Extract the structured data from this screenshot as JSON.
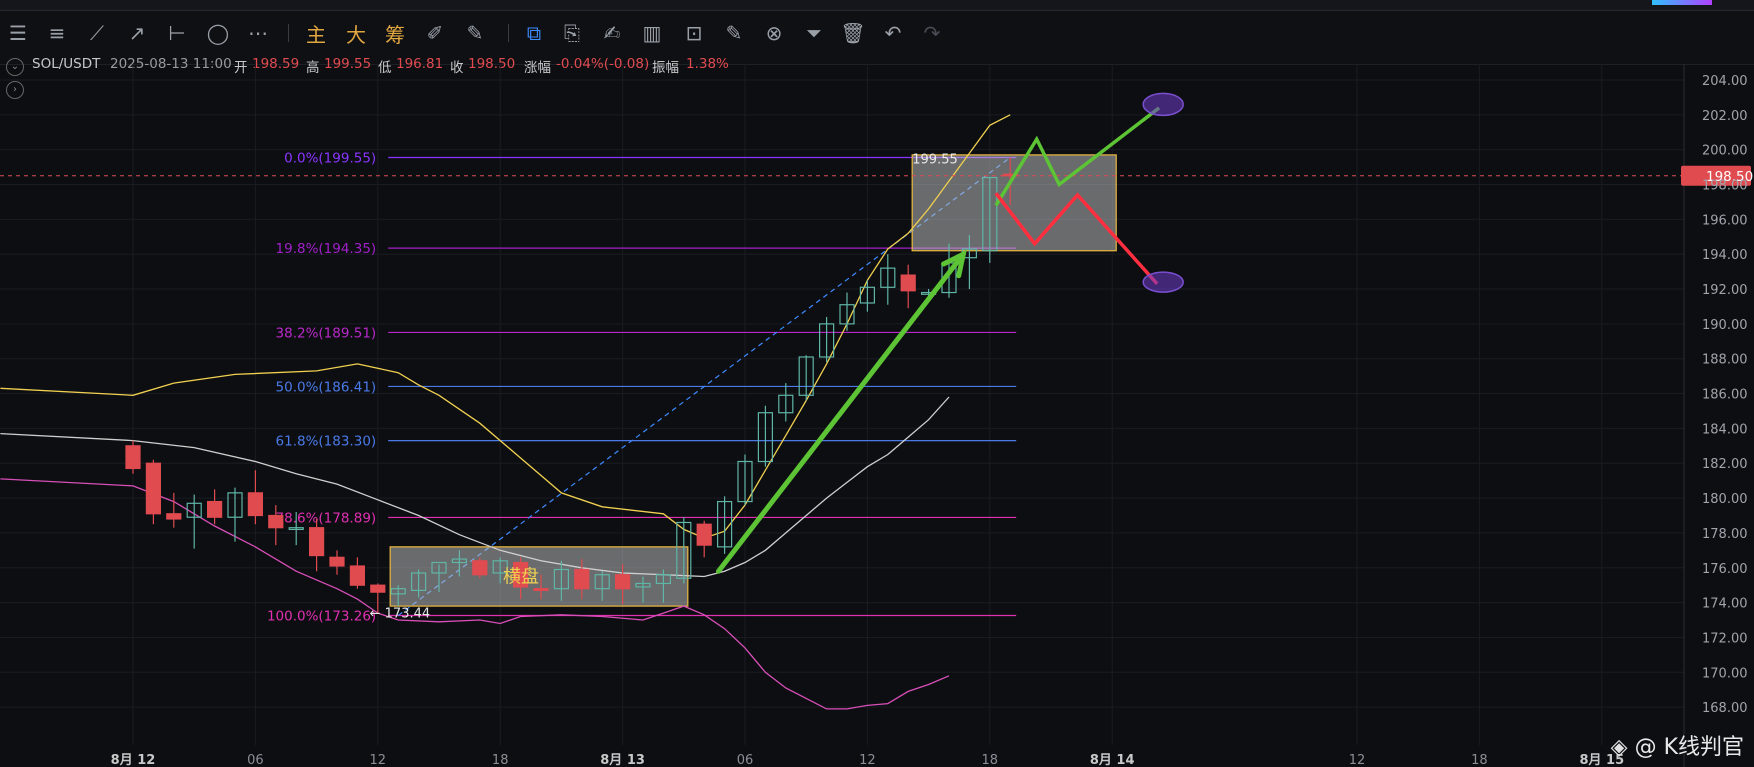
{
  "toolbar": {
    "left_tools": [
      "menu-icon",
      "horizontal-lines-icon",
      "trend-line-icon",
      "ray-icon",
      "horizontal-line-icon",
      "ellipse-icon",
      "more-icon"
    ],
    "indicator_buttons": [
      "主",
      "大",
      "筹"
    ],
    "right_tools": [
      "replay-icon",
      "brush-icon",
      "copy-icon",
      "ruler-icon",
      "pen-icon",
      "candle-type-icon",
      "lock-icon",
      "edit-icon",
      "magnet-icon",
      "filter-icon",
      "trash-icon",
      "undo-icon",
      "redo-icon"
    ]
  },
  "info": {
    "symbol": "SOL/USDT",
    "datetime": "2025-08-13 11:00",
    "open_label": "开",
    "open": "198.59",
    "high_label": "高",
    "high": "199.55",
    "low_label": "低",
    "low": "196.81",
    "close_label": "收",
    "close": "198.50",
    "change_label": "涨幅",
    "change": "-0.04%(-0.08)",
    "amplitude_label": "振幅",
    "amplitude": "1.38%"
  },
  "watermark": "@ K线判官",
  "colors": {
    "background": "#0d0e12",
    "up": "#5fb5a6",
    "down": "#e04b50",
    "price_tag": "#e04b50",
    "boll_upper": "#f0d050",
    "boll_mid": "#cfcfcf",
    "boll_lower": "#d84fb8",
    "arrow": "#5cc435",
    "green_path": "#5cc435",
    "red_path": "#ff2f3f",
    "ellipse": "#7a4fd0"
  },
  "chart_data": {
    "type": "candlestick",
    "symbol": "SOL/USDT",
    "interval_hours": 1,
    "ylim": [
      167,
      205
    ],
    "y_ticks": [
      "204.00",
      "202.00",
      "200.00",
      "198.00",
      "196.00",
      "194.00",
      "192.00",
      "190.00",
      "188.00",
      "186.00",
      "184.00",
      "182.00",
      "180.00",
      "178.00",
      "176.00",
      "174.00",
      "172.00",
      "170.00",
      "168.00"
    ],
    "x_ticks": [
      {
        "label": "8月 12",
        "t": 0,
        "bold": true
      },
      {
        "label": "06",
        "t": 6
      },
      {
        "label": "12",
        "t": 12
      },
      {
        "label": "18",
        "t": 18
      },
      {
        "label": "8月 13",
        "t": 24,
        "bold": true
      },
      {
        "label": "06",
        "t": 30
      },
      {
        "label": "12",
        "t": 36
      },
      {
        "label": "18",
        "t": 42
      },
      {
        "label": "8月 14",
        "t": 48,
        "bold": true
      },
      {
        "label": "12",
        "t": 60
      },
      {
        "label": "18",
        "t": 66
      },
      {
        "label": "8月 15",
        "t": 72,
        "bold": true
      }
    ],
    "current_price": "198.50",
    "candles": [
      {
        "o": 183.0,
        "h": 183.3,
        "l": 181.4,
        "c": 181.7
      },
      {
        "o": 182.0,
        "h": 182.2,
        "l": 178.5,
        "c": 179.1
      },
      {
        "o": 179.1,
        "h": 180.3,
        "l": 178.3,
        "c": 178.8
      },
      {
        "o": 178.9,
        "h": 180.2,
        "l": 177.1,
        "c": 179.7
      },
      {
        "o": 179.8,
        "h": 180.5,
        "l": 178.5,
        "c": 178.9
      },
      {
        "o": 178.9,
        "h": 180.6,
        "l": 177.5,
        "c": 180.3
      },
      {
        "o": 180.3,
        "h": 181.6,
        "l": 178.5,
        "c": 179.0
      },
      {
        "o": 179.0,
        "h": 179.6,
        "l": 177.3,
        "c": 178.3
      },
      {
        "o": 178.2,
        "h": 179.2,
        "l": 177.3,
        "c": 178.3
      },
      {
        "o": 178.3,
        "h": 178.8,
        "l": 175.8,
        "c": 176.7
      },
      {
        "o": 176.6,
        "h": 177.0,
        "l": 175.6,
        "c": 176.1
      },
      {
        "o": 176.1,
        "h": 176.6,
        "l": 174.8,
        "c": 175.0
      },
      {
        "o": 175.0,
        "h": 175.1,
        "l": 173.4,
        "c": 174.6
      },
      {
        "o": 174.5,
        "h": 175.0,
        "l": 173.8,
        "c": 174.8
      },
      {
        "o": 174.7,
        "h": 175.9,
        "l": 174.3,
        "c": 175.7
      },
      {
        "o": 175.7,
        "h": 176.2,
        "l": 174.6,
        "c": 176.3
      },
      {
        "o": 176.3,
        "h": 177.0,
        "l": 175.5,
        "c": 176.5
      },
      {
        "o": 176.4,
        "h": 176.6,
        "l": 175.4,
        "c": 175.6
      },
      {
        "o": 175.7,
        "h": 176.6,
        "l": 175.1,
        "c": 176.4
      },
      {
        "o": 176.3,
        "h": 176.6,
        "l": 174.2,
        "c": 174.9
      },
      {
        "o": 174.8,
        "h": 175.6,
        "l": 174.2,
        "c": 174.7
      },
      {
        "o": 174.8,
        "h": 176.4,
        "l": 174.1,
        "c": 175.9
      },
      {
        "o": 175.9,
        "h": 176.5,
        "l": 174.2,
        "c": 174.8
      },
      {
        "o": 174.8,
        "h": 175.8,
        "l": 174.1,
        "c": 175.6
      },
      {
        "o": 175.6,
        "h": 176.2,
        "l": 173.9,
        "c": 174.8
      },
      {
        "o": 174.9,
        "h": 175.5,
        "l": 174.0,
        "c": 175.1
      },
      {
        "o": 175.1,
        "h": 175.9,
        "l": 174.0,
        "c": 175.6
      },
      {
        "o": 175.4,
        "h": 178.9,
        "l": 175.1,
        "c": 178.6
      },
      {
        "o": 178.5,
        "h": 178.7,
        "l": 176.6,
        "c": 177.3
      },
      {
        "o": 177.2,
        "h": 180.1,
        "l": 176.8,
        "c": 179.8
      },
      {
        "o": 179.8,
        "h": 182.5,
        "l": 179.6,
        "c": 182.1
      },
      {
        "o": 182.1,
        "h": 185.3,
        "l": 181.8,
        "c": 184.9
      },
      {
        "o": 184.9,
        "h": 186.6,
        "l": 184.4,
        "c": 185.9
      },
      {
        "o": 185.9,
        "h": 188.2,
        "l": 185.6,
        "c": 188.1
      },
      {
        "o": 188.1,
        "h": 190.4,
        "l": 187.8,
        "c": 190.0
      },
      {
        "o": 190.0,
        "h": 191.8,
        "l": 189.6,
        "c": 191.1
      },
      {
        "o": 191.2,
        "h": 192.5,
        "l": 190.7,
        "c": 192.1
      },
      {
        "o": 192.1,
        "h": 194.0,
        "l": 191.1,
        "c": 193.2
      },
      {
        "o": 192.8,
        "h": 193.4,
        "l": 190.9,
        "c": 191.9
      },
      {
        "o": 191.7,
        "h": 192.0,
        "l": 191.3,
        "c": 191.8
      },
      {
        "o": 191.8,
        "h": 194.6,
        "l": 191.5,
        "c": 193.5
      },
      {
        "o": 193.8,
        "h": 195.1,
        "l": 192.0,
        "c": 194.3
      },
      {
        "o": 194.2,
        "h": 198.4,
        "l": 193.5,
        "c": 198.4
      },
      {
        "o": 198.59,
        "h": 199.55,
        "l": 196.81,
        "c": 198.5
      }
    ],
    "bollinger": {
      "upper": [
        [
          0,
          185.9
        ],
        [
          2,
          186.6
        ],
        [
          5,
          187.1
        ],
        [
          9,
          187.3
        ],
        [
          11,
          187.7
        ],
        [
          13,
          187.2
        ],
        [
          14,
          186.5
        ],
        [
          15,
          185.9
        ],
        [
          17,
          184.3
        ],
        [
          19,
          182.3
        ],
        [
          21,
          180.3
        ],
        [
          23,
          179.5
        ],
        [
          26,
          179.1
        ],
        [
          27,
          178.2
        ],
        [
          28,
          177.7
        ],
        [
          29,
          178.1
        ],
        [
          30,
          179.6
        ],
        [
          31,
          181.6
        ],
        [
          32,
          183.6
        ],
        [
          33,
          185.6
        ],
        [
          34,
          187.7
        ],
        [
          35,
          190.0
        ],
        [
          36,
          192.5
        ],
        [
          37,
          194.3
        ],
        [
          38,
          195.2
        ],
        [
          39,
          196.6
        ],
        [
          40,
          198.2
        ],
        [
          41,
          199.8
        ],
        [
          42,
          201.4
        ],
        [
          43,
          202.0
        ]
      ],
      "middle": [
        [
          0,
          183.3
        ],
        [
          3,
          182.9
        ],
        [
          6,
          182.1
        ],
        [
          8,
          181.4
        ],
        [
          10,
          180.8
        ],
        [
          12,
          179.9
        ],
        [
          14,
          179.0
        ],
        [
          16,
          177.9
        ],
        [
          18,
          177.0
        ],
        [
          20,
          176.4
        ],
        [
          22,
          176.0
        ],
        [
          24,
          175.7
        ],
        [
          26,
          175.6
        ],
        [
          28,
          175.5
        ],
        [
          29,
          175.8
        ],
        [
          30,
          176.3
        ],
        [
          31,
          177.0
        ],
        [
          32,
          178.0
        ],
        [
          33,
          179.0
        ],
        [
          34,
          180.0
        ],
        [
          35,
          180.9
        ],
        [
          36,
          181.8
        ],
        [
          37,
          182.5
        ],
        [
          38,
          183.5
        ],
        [
          39,
          184.5
        ],
        [
          40,
          185.8
        ]
      ],
      "lower": [
        [
          0,
          180.7
        ],
        [
          2,
          179.8
        ],
        [
          4,
          178.4
        ],
        [
          6,
          177.2
        ],
        [
          8,
          175.8
        ],
        [
          10,
          174.8
        ],
        [
          11,
          174.2
        ],
        [
          12,
          173.4
        ],
        [
          13,
          173.0
        ],
        [
          15,
          172.9
        ],
        [
          17,
          173.0
        ],
        [
          18,
          172.8
        ],
        [
          19,
          173.2
        ],
        [
          21,
          173.3
        ],
        [
          23,
          173.2
        ],
        [
          25,
          173.0
        ],
        [
          26,
          173.4
        ],
        [
          27,
          173.8
        ],
        [
          28,
          173.3
        ],
        [
          29,
          172.5
        ],
        [
          30,
          171.4
        ],
        [
          31,
          170.0
        ],
        [
          32,
          169.1
        ],
        [
          33,
          168.5
        ],
        [
          34,
          167.9
        ],
        [
          35,
          167.9
        ],
        [
          36,
          168.1
        ],
        [
          37,
          168.2
        ],
        [
          38,
          168.9
        ],
        [
          39,
          169.3
        ],
        [
          40,
          169.8
        ]
      ]
    },
    "fibonacci": {
      "x_range": [
        13,
        43
      ],
      "levels": [
        {
          "label": "0.0%(199.55)",
          "price": 199.55,
          "color": "#8a35ff"
        },
        {
          "label": "19.8%(194.35)",
          "price": 194.35,
          "color": "#a020c8"
        },
        {
          "label": "38.2%(189.51)",
          "price": 189.51,
          "color": "#b828c8"
        },
        {
          "label": "50.0%(186.41)",
          "price": 186.41,
          "color": "#4a7ae8"
        },
        {
          "label": "61.8%(183.30)",
          "price": 183.3,
          "color": "#4a7ae8"
        },
        {
          "label": "78.6%(178.89)",
          "price": 178.89,
          "color": "#e030b0"
        },
        {
          "label": "100.0%(173.26)",
          "price": 173.26,
          "color": "#e030b0"
        }
      ],
      "trend_start": {
        "t": 13,
        "price": 173.26
      },
      "trend_end": {
        "t": 43,
        "price": 199.55
      }
    },
    "annotations": {
      "low_label": "173.44",
      "high_label": "199.55",
      "consolidation_label": "横盘",
      "consolidation_box": {
        "t0": 13,
        "t1": 27,
        "p0": 173.8,
        "p1": 177.2
      },
      "top_box": {
        "t0": 38,
        "t1": 48,
        "p0": 194.2,
        "p1": 199.7
      },
      "arrow": {
        "from": {
          "t": 28.7,
          "price": 175.8
        },
        "to": {
          "t": 40.7,
          "price": 194.0
        }
      },
      "green_path": [
        [
          42.3,
          196.8
        ],
        [
          44.3,
          200.6
        ],
        [
          45.4,
          198.0
        ],
        [
          50.3,
          202.4
        ]
      ],
      "red_path": [
        [
          42.3,
          197.5
        ],
        [
          44.2,
          194.6
        ],
        [
          46.3,
          197.4
        ],
        [
          50.2,
          192.3
        ]
      ],
      "ellipse_top": {
        "t": 50.5,
        "price": 202.6
      },
      "ellipse_bottom": {
        "t": 50.5,
        "price": 192.4
      }
    }
  }
}
